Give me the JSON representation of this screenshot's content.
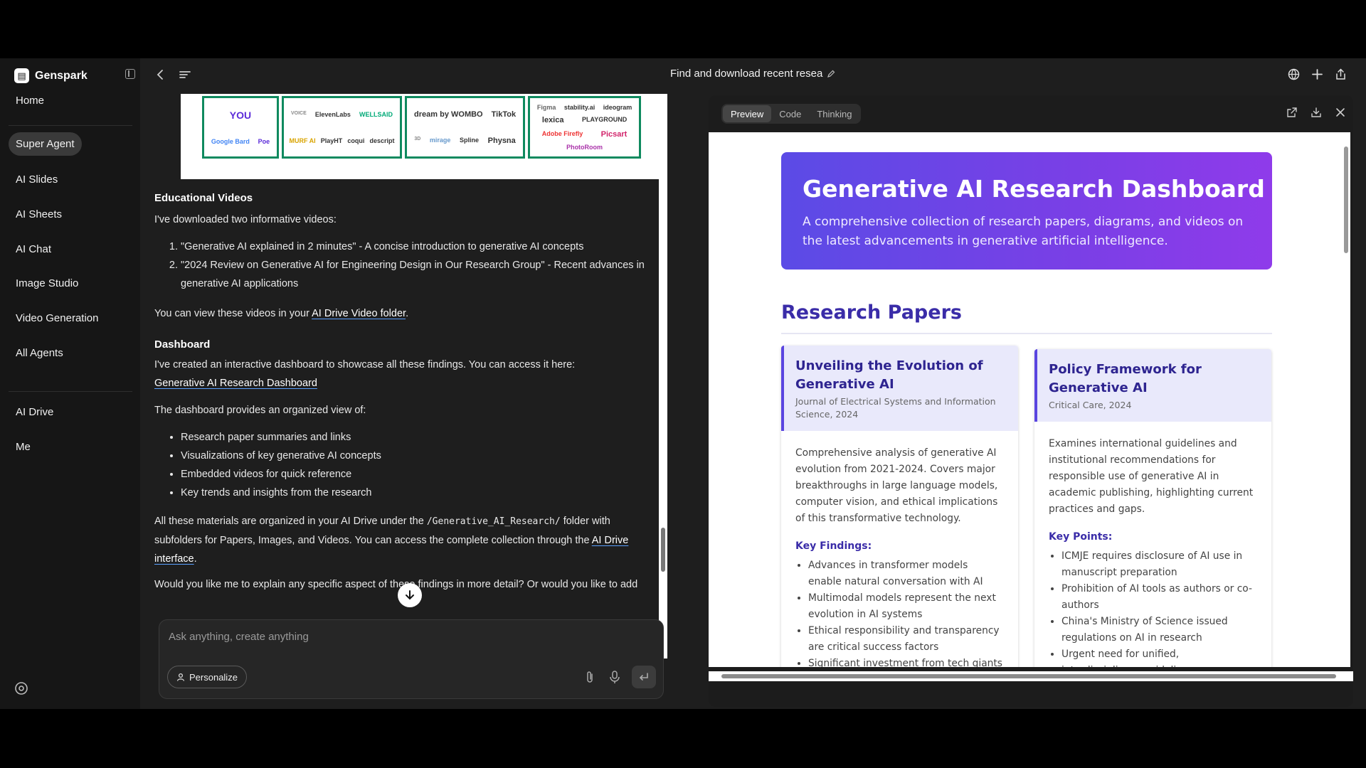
{
  "sidebar": {
    "brand": "Genspark",
    "items": [
      {
        "label": "Home"
      },
      {
        "label": "Super Agent",
        "active": true
      },
      {
        "label": "AI Slides"
      },
      {
        "label": "AI Sheets"
      },
      {
        "label": "AI Chat"
      },
      {
        "label": "Image Studio"
      },
      {
        "label": "Video Generation"
      },
      {
        "label": "All Agents"
      },
      {
        "label": "AI Drive"
      },
      {
        "label": "Me"
      }
    ]
  },
  "topbar": {
    "title": "Find and download recent resea"
  },
  "logo_image": {
    "chips": [
      "YOU",
      "Google Bard",
      "Poe",
      "VOICE",
      "ElevenLabs",
      "WELLSAID",
      "MURF AI",
      "PlayHT",
      "coqui",
      "descript",
      "dream by WOMBO",
      "TikTok",
      "3D",
      "mirage",
      "Spline",
      "Physna",
      "Figma",
      "stability.ai",
      "ideogram",
      "lexica",
      "PLAYGROUND",
      "Adobe Firefly",
      "Picsart",
      "PhotoRoom"
    ]
  },
  "chat": {
    "videos_heading": "Educational Videos",
    "videos_intro": "I've downloaded two informative videos:",
    "videos": [
      "\"Generative AI explained in 2 minutes\" - A concise introduction to generative AI concepts",
      "\"2024 Review on Generative AI for Engineering Design in Our Research Group\" - Recent advances in generative AI applications"
    ],
    "videos_view_pre": "You can view these videos in your ",
    "videos_link": "AI Drive Video folder",
    "videos_view_post": ".",
    "dashboard_heading": "Dashboard",
    "dashboard_intro": "I've created an interactive dashboard to showcase all these findings. You can access it here:",
    "dashboard_link": "Generative AI Research Dashboard",
    "dashboard_provides": "The dashboard provides an organized view of:",
    "dashboard_items": [
      "Research paper summaries and links",
      "Visualizations of key generative AI concepts",
      "Embedded videos for quick reference",
      "Key trends and insights from the research"
    ],
    "organized_pre": "All these materials are organized in your AI Drive under the ",
    "organized_code": "/Generative_AI_Research/",
    "organized_mid": " folder with subfolders for Papers, Images, and Videos. You can access the complete collection through the ",
    "organized_link": "AI Drive interface",
    "organized_post": ".",
    "followup": "Would you like me to explain any specific aspect of these findings in more detail? Or would you like to add",
    "composer_placeholder": "Ask anything, create anything",
    "personalize_label": "Personalize"
  },
  "preview": {
    "tabs": [
      {
        "label": "Preview",
        "active": true
      },
      {
        "label": "Code"
      },
      {
        "label": "Thinking"
      }
    ],
    "hero_title": "Generative AI Research Dashboard",
    "hero_desc": "A comprehensive collection of research papers, diagrams, and videos on the latest advancements in generative artificial intelligence.",
    "section_title": "Research Papers",
    "cards": [
      {
        "title": "Unveiling the Evolution of Generative AI",
        "source": "Journal of Electrical Systems and Information Science, 2024",
        "summary": "Comprehensive analysis of generative AI evolution from 2021-2024. Covers major breakthroughs in large language models, computer vision, and ethical implications of this transformative technology.",
        "points_heading": "Key Findings:",
        "points": [
          "Advances in transformer models enable natural conversation with AI",
          "Multimodal models represent the next evolution in AI systems",
          "Ethical responsibility and transparency are critical success factors",
          "Significant investment from tech giants"
        ]
      },
      {
        "title": "Policy Framework for Generative AI",
        "source": "Critical Care, 2024",
        "summary": "Examines international guidelines and institutional recommendations for responsible use of generative AI in academic publishing, highlighting current practices and gaps.",
        "points_heading": "Key Points:",
        "points": [
          "ICMJE requires disclosure of AI use in manuscript preparation",
          "Prohibition of AI tools as authors or co-authors",
          "China's Ministry of Science issued regulations on AI in research",
          "Urgent need for unified, interdisciplinary guidelines"
        ]
      }
    ]
  },
  "colors": {
    "hero_gradient_start": "#5b4be6",
    "hero_gradient_end": "#8f3bea",
    "accent_purple": "#3a2ca8",
    "link_underline": "#5aa0ff"
  }
}
